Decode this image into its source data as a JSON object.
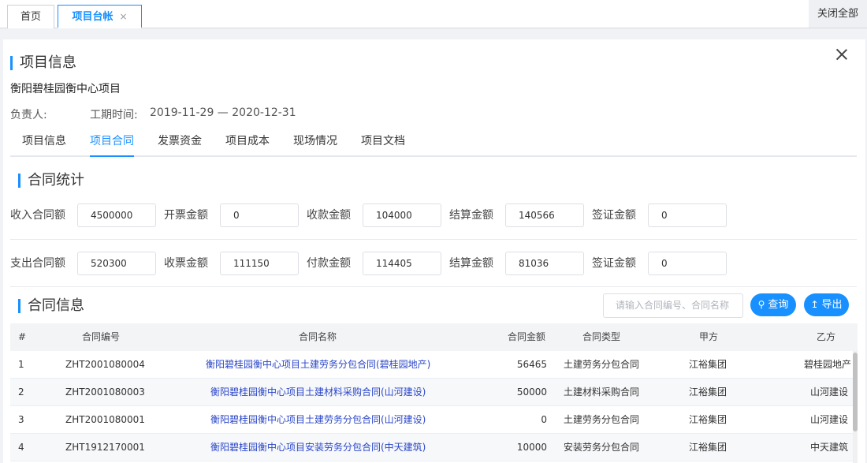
{
  "tabs": {
    "home": "首页",
    "active": "项目台帐",
    "close_glyph": "×",
    "close_all": "关闭全部"
  },
  "project": {
    "section_title": "项目信息",
    "name": "衡阳碧桂园衡中心项目",
    "owner_label": "负责人:",
    "period_label": "工期时间:",
    "period_value": "2019-11-29 — 2020-12-31"
  },
  "subtabs": [
    "项目信息",
    "项目合同",
    "发票资金",
    "项目成本",
    "现场情况",
    "项目文档"
  ],
  "stats": {
    "title": "合同统计",
    "income": [
      {
        "label": "收入合同额",
        "value": "4500000"
      },
      {
        "label": "开票金额",
        "value": "0"
      },
      {
        "label": "收款金额",
        "value": "104000"
      },
      {
        "label": "结算金额",
        "value": "140566"
      },
      {
        "label": "签证金额",
        "value": "0"
      }
    ],
    "expense": [
      {
        "label": "支出合同额",
        "value": "520300"
      },
      {
        "label": "收票金额",
        "value": "111150"
      },
      {
        "label": "付款金额",
        "value": "114405"
      },
      {
        "label": "结算金额",
        "value": "81036"
      },
      {
        "label": "签证金额",
        "value": "0"
      }
    ]
  },
  "contracts": {
    "title": "合同信息",
    "search_placeholder": "请输入合同编号、合同名称",
    "query_label": "查询",
    "export_label": "导出",
    "columns": [
      "#",
      "合同编号",
      "合同名称",
      "合同金额",
      "合同类型",
      "甲方",
      "乙方"
    ],
    "rows": [
      {
        "no": "1",
        "code": "ZHT2001080004",
        "name": "衡阳碧桂园衡中心项目土建劳务分包合同(碧桂园地产)",
        "amount": "56465",
        "type": "土建劳务分包合同",
        "party_a": "江裕集团",
        "party_b": "碧桂园地产"
      },
      {
        "no": "2",
        "code": "ZHT2001080003",
        "name": "衡阳碧桂园衡中心项目土建材料采购合同(山河建设)",
        "amount": "50000",
        "type": "土建材料采购合同",
        "party_a": "江裕集团",
        "party_b": "山河建设"
      },
      {
        "no": "3",
        "code": "ZHT2001080001",
        "name": "衡阳碧桂园衡中心项目土建劳务分包合同(山河建设)",
        "amount": "0",
        "type": "土建劳务分包合同",
        "party_a": "江裕集团",
        "party_b": "山河建设"
      },
      {
        "no": "4",
        "code": "ZHT1912170001",
        "name": "衡阳碧桂园衡中心项目安装劳务分包合同(中天建筑)",
        "amount": "10000",
        "type": "安装劳务分包合同",
        "party_a": "江裕集团",
        "party_b": "中天建筑"
      }
    ]
  }
}
